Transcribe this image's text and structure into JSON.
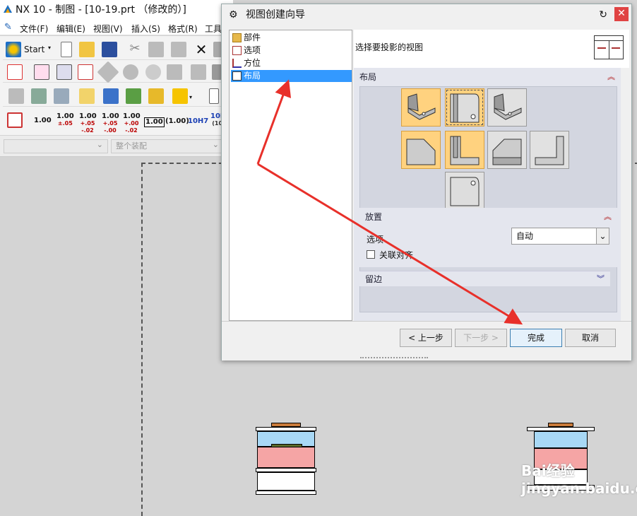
{
  "window": {
    "title": "NX 10 - 制图 - [10-19.prt （修改的）]"
  },
  "menu": [
    "文件(F)",
    "编辑(E)",
    "视图(V)",
    "插入(S)",
    "格式(R)",
    "工具"
  ],
  "toolbar": {
    "start_label": "Start",
    "numbers": [
      {
        "main": "1.00",
        "sub": ""
      },
      {
        "main": "1.00",
        "sub": "±.05"
      },
      {
        "main": "1.00",
        "sub": "+.05 -.02"
      },
      {
        "main": "1.00",
        "sub": "+.05 -.00"
      },
      {
        "main": "1.00",
        "sub": "+.00 -.02"
      },
      {
        "main": "1.00",
        "sub": ""
      },
      {
        "main": "(1.00)",
        "sub": ""
      },
      {
        "main": "10H7",
        "sub": ""
      },
      {
        "main": "10H",
        "sub": "(10."
      }
    ]
  },
  "filterbar": {
    "combo1": "",
    "combo2": "整个装配"
  },
  "dialog": {
    "title": "视图创建向导",
    "tree": [
      {
        "label": "部件",
        "icon": "part-icon"
      },
      {
        "label": "选项",
        "icon": "options-icon"
      },
      {
        "label": "方位",
        "icon": "orientation-icon"
      },
      {
        "label": "布局",
        "icon": "layout-icon",
        "selected": true
      }
    ],
    "instruction": "选择要投影的视图",
    "layout_section": "布局",
    "placement_section": "放置",
    "option_label": "选项",
    "option_value": "自动",
    "assoc_align_label": "关联对齐",
    "assoc_align_checked": false,
    "margin_section": "留边",
    "buttons": {
      "back": "< 上一步",
      "next": "下一步 >",
      "finish": "完成",
      "cancel": "取消"
    }
  },
  "colors": {
    "selected_view": "#ffd27f",
    "tree_selection": "#3399ff",
    "arrow": "#e8302a"
  },
  "watermark": "Bai经验\njingyan.baidu.com"
}
